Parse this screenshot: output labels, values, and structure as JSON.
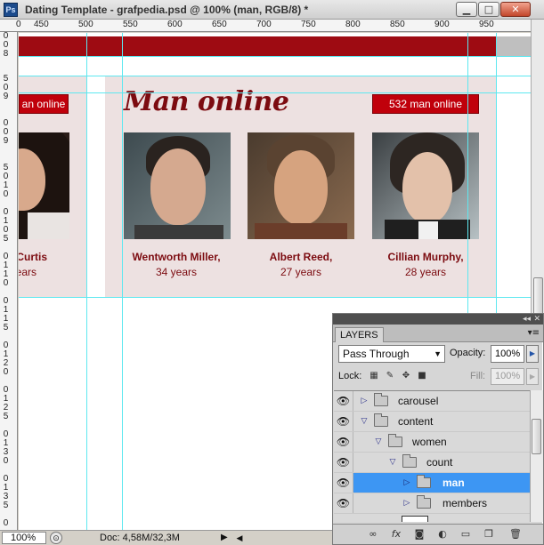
{
  "window": {
    "app_icon": "Ps",
    "title": "Dating Template - grafpedia.psd @ 100% (man, RGB/8) *",
    "minimize": "▁",
    "maximize": "□",
    "close": "✕"
  },
  "ruler": {
    "horizontal_labels": [
      "0",
      "450",
      "500",
      "550",
      "600",
      "650",
      "700",
      "750",
      "800",
      "850",
      "900",
      "950"
    ],
    "vertical_labels": [
      "0",
      "0",
      "8",
      "5",
      "0",
      "9",
      "0",
      "0",
      "9",
      "5",
      "0",
      "1",
      "0",
      "0",
      "1",
      "0",
      "5",
      "0",
      "1",
      "1",
      "0",
      "0",
      "1",
      "1",
      "5",
      "0",
      "1",
      "2",
      "0",
      "0",
      "1",
      "2",
      "5",
      "0",
      "1",
      "3",
      "0",
      "0",
      "1",
      "3",
      "5",
      "0"
    ]
  },
  "canvas": {
    "left_badge": "an online",
    "section_title": "Man online",
    "count_badge": "532 man online",
    "profiles": [
      {
        "name": "Curtis,",
        "age": "ears"
      },
      {
        "name": "Wentworth Miller,",
        "age": "34 years"
      },
      {
        "name": "Albert Reed,",
        "age": "27 years"
      },
      {
        "name": "Cillian Murphy,",
        "age": "28 years"
      }
    ]
  },
  "status": {
    "zoom": "100%",
    "doc_info": "Doc: 4,58M/32,3M",
    "arrow": "▶",
    "scroll_left": "◀"
  },
  "layers_panel": {
    "tab_label": "LAYERS",
    "collapse": "◂◂",
    "close": "✕",
    "menu_icon": "▾≡",
    "blend_mode": "Pass Through",
    "opacity_label": "Opacity:",
    "opacity_value": "100%",
    "lock_label": "Lock:",
    "fill_label": "Fill:",
    "fill_value": "100%",
    "layers": [
      {
        "name": "carousel",
        "expanded": false,
        "depth": 0,
        "selected": false
      },
      {
        "name": "content",
        "expanded": true,
        "depth": 0,
        "selected": false
      },
      {
        "name": "women",
        "expanded": true,
        "depth": 1,
        "selected": false
      },
      {
        "name": "count",
        "expanded": true,
        "depth": 2,
        "selected": false
      },
      {
        "name": "man",
        "expanded": false,
        "depth": 3,
        "selected": true
      },
      {
        "name": "members",
        "expanded": false,
        "depth": 3,
        "selected": false
      }
    ],
    "footer_icons": [
      "link-icon",
      "fx-icon",
      "mask-icon",
      "adjustment-icon",
      "new-group-icon",
      "new-layer-icon",
      "trash-icon"
    ]
  },
  "colors": {
    "brand_red": "#9e0b12",
    "badge_red": "#c0000b",
    "title_red": "#7c0b10",
    "panel_bg": "#ede1e1",
    "guide": "#5ee8f0",
    "selection": "#3d96f3"
  }
}
